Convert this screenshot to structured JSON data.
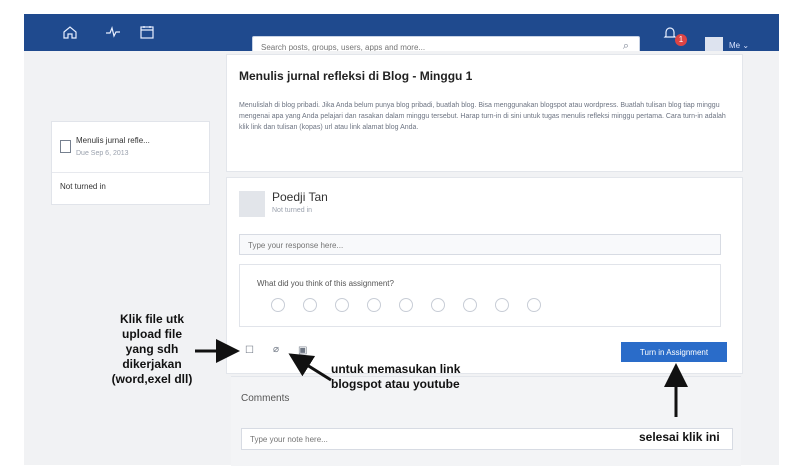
{
  "topbar": {
    "search_placeholder": "Search posts, groups, users, apps and more...",
    "notifications_count": "1",
    "user_menu_label": "Me"
  },
  "left_panel": {
    "assignment_title": "Menulis jurnal refle...",
    "due": "Due Sep 6, 2013",
    "status": "Not turned in"
  },
  "assignment_card": {
    "title": "Menulis jurnal refleksi di Blog - Minggu 1",
    "body": "Menulislah di blog pribadi. Jika Anda belum punya blog pribadi, buatlah blog. Bisa menggunakan blogspot atau wordpress. Buatlah tulisan blog tiap minggu mengenai apa yang Anda pelajari dan rasakan dalam minggu tersebut. Harap turn-in di sini untuk tugas menulis refleksi minggu pertama. Cara turn-in adalah klik link dan tulisan (kopas) url atau link alamat blog Anda."
  },
  "response_card": {
    "user_name": "Poedji Tan",
    "status": "Not turned in",
    "response_placeholder": "Type your response here...",
    "feedback_question": "What did you think of this assignment?",
    "turn_in_label": "Turn in Assignment"
  },
  "comments": {
    "title": "Comments",
    "placeholder": "Type your note here..."
  },
  "annotations": {
    "left_note": "Klik file utk\nupload file\nyang sdh\ndikerjakan\n(word,exel dll)",
    "middle_note": "untuk memasukan link\nblogspot atau youtube",
    "right_note": "selesai klik ini"
  },
  "icons": {
    "home": "home-icon",
    "activity": "activity-icon",
    "calendar": "calendar-icon",
    "search": "search-icon",
    "notifications": "bell-icon",
    "attach_file": "file-icon",
    "attach_link": "link-icon",
    "attach_more": "library-icon"
  },
  "colors": {
    "topbar": "#1f4a8e",
    "button": "#2a6cc9",
    "badge": "#d44"
  }
}
